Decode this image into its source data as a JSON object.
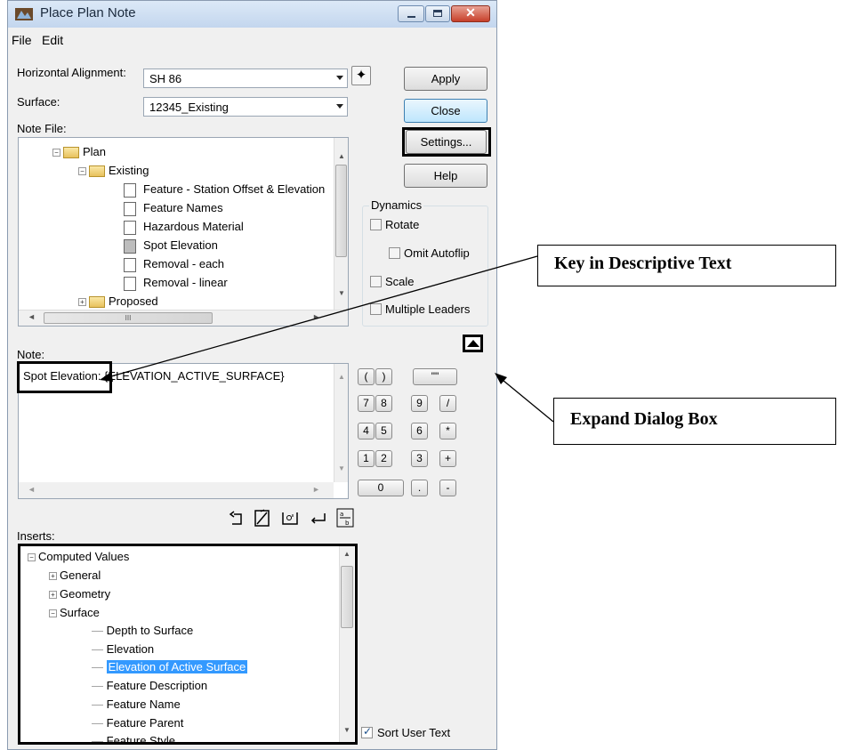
{
  "window": {
    "title": "Place Plan Note",
    "menu": [
      "File",
      "Edit"
    ]
  },
  "form": {
    "horizontal_alignment_label": "Horizontal Alignment:",
    "horizontal_alignment_value": "SH 86",
    "surface_label": "Surface:",
    "surface_value": "12345_Existing",
    "note_file_label": "Note File:",
    "note_label": "Note:",
    "note_text": "Spot Elevation: {ELEVATION_ACTIVE_SURFACE}",
    "inserts_label": "Inserts:"
  },
  "buttons": {
    "apply": "Apply",
    "close": "Close",
    "settings": "Settings...",
    "help": "Help"
  },
  "note_file_tree": {
    "root": "Plan",
    "folder": "Existing",
    "items": [
      "Feature - Station Offset & Elevation",
      "Feature Names",
      "Hazardous Material",
      "Spot Elevation",
      "Removal - each",
      "Removal - linear"
    ],
    "next_folder": "Proposed",
    "hscroll_glyph": "III"
  },
  "dynamics": {
    "title": "Dynamics",
    "rotate": "Rotate",
    "omit_autoflip": "Omit Autoflip",
    "scale": "Scale",
    "multiple_leaders": "Multiple Leaders"
  },
  "keypad": {
    "row1": [
      "(",
      ")",
      "\"\""
    ],
    "row2": [
      "7",
      "8",
      "9",
      "/"
    ],
    "row3": [
      "4",
      "5",
      "6",
      "*"
    ],
    "row4": [
      "1",
      "2",
      "3",
      "+"
    ],
    "row5": [
      "0",
      ".",
      "-"
    ]
  },
  "inserts_tree": {
    "root": "Computed Values",
    "groups": [
      "General",
      "Geometry",
      "Surface"
    ],
    "surface_items": [
      "Depth to Surface",
      "Elevation",
      "Elevation of Active Surface",
      "Feature Description",
      "Feature Name",
      "Feature Parent",
      "Feature Style"
    ],
    "selected": "Elevation of Active Surface"
  },
  "sort_user_text": {
    "label": "Sort User Text",
    "checked": true
  },
  "callouts": {
    "descriptive": "Key in Descriptive Text",
    "expand": "Expand Dialog Box"
  },
  "colors": {
    "selection": "#3399ff",
    "dialog_bg": "#f0f0f0"
  }
}
